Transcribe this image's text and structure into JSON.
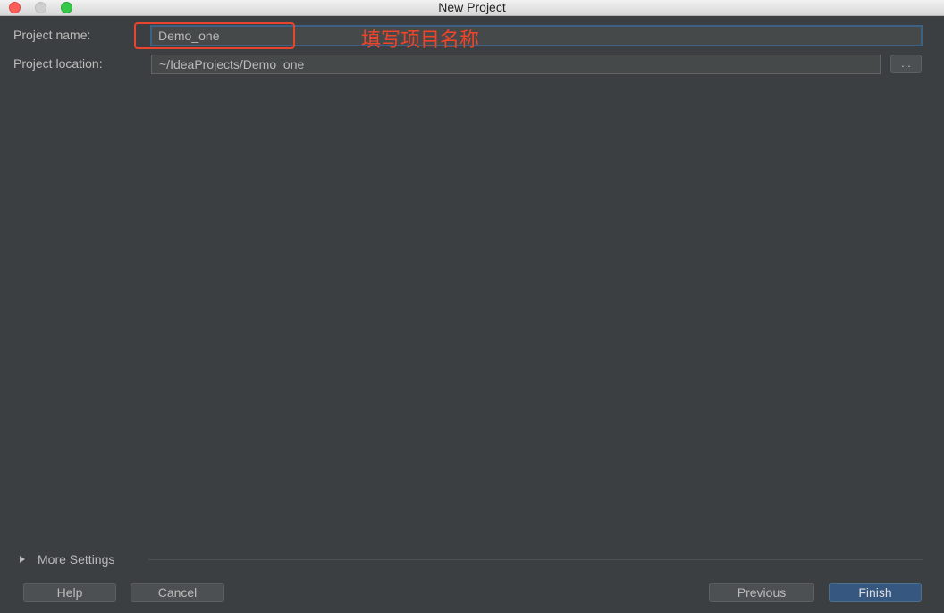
{
  "window": {
    "title": "New Project"
  },
  "form": {
    "project_name_label": "Project name:",
    "project_name_value": "Demo_one",
    "project_location_label": "Project location:",
    "project_location_value": "~/IdeaProjects/Demo_one",
    "browse_label": "..."
  },
  "annotation": {
    "text": "填写项目名称",
    "color": "#f0442a"
  },
  "more_settings": {
    "label": "More Settings"
  },
  "buttons": {
    "help": "Help",
    "cancel": "Cancel",
    "previous": "Previous",
    "finish": "Finish"
  },
  "colors": {
    "background": "#3c3f41",
    "accent": "#365880",
    "focus_border": "#3d6185",
    "annotation_border": "#e8452c"
  }
}
